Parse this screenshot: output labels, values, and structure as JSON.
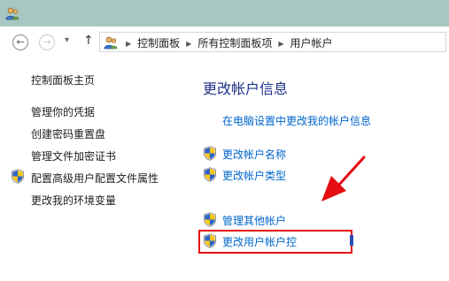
{
  "breadcrumb": [
    "控制面板",
    "所有控制面板项",
    "用户帐户"
  ],
  "left_nav": {
    "home": "控制面板主页",
    "items": [
      "管理你的凭据",
      "创建密码重置盘",
      "管理文件加密证书",
      "配置高级用户配置文件属性",
      "更改我的环境变量"
    ]
  },
  "main": {
    "title": "更改帐户信息",
    "pc_settings_link": "在电脑设置中更改我的帐户信息",
    "tasks": [
      "更改帐户名称",
      "更改帐户类型",
      "管理其他帐户",
      "更改用户帐户控"
    ]
  },
  "icons": {
    "title": "users-icon",
    "back": "back-arrow-icon",
    "forward": "forward-arrow-icon",
    "recent": "chevron-down-icon",
    "up": "up-arrow-icon",
    "address": "users-icon",
    "task": "uac-shield-icon"
  },
  "colors": {
    "titlebar": "#a9c7c2",
    "link": "#0066cc",
    "heading": "#1e3287",
    "highlight": "#e30d12"
  }
}
